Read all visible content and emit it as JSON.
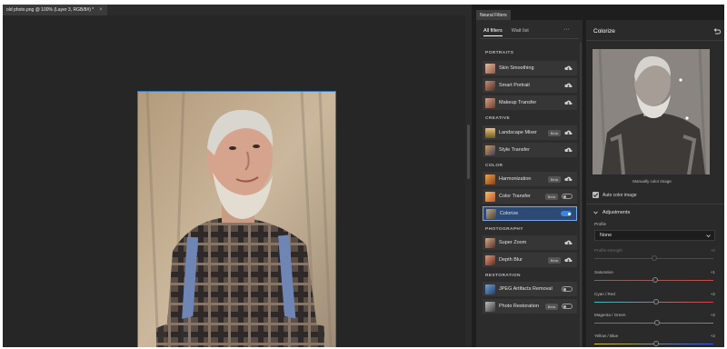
{
  "document": {
    "tab_title": "old photo.png @ 100% (Layer 3, RGB/8#) *",
    "close_icon": "close-icon"
  },
  "neural_filters": {
    "panel_tab": "Neural Filters",
    "tabs": [
      "All filters",
      "Wait list"
    ],
    "more_icon": "more-icon",
    "categories": {
      "portraits": "PORTRAITS",
      "creative": "CREATIVE",
      "color": "COLOR",
      "photography": "PHOTOGRAPHY",
      "restoration": "RESTORATION"
    },
    "filters": {
      "skin_smoothing": {
        "label": "Skin Smoothing"
      },
      "smart_portrait": {
        "label": "Smart Portrait"
      },
      "makeup_transfer": {
        "label": "Makeup Transfer"
      },
      "landscape_mixer": {
        "label": "Landscape Mixer",
        "badge": "Beta"
      },
      "style_transfer": {
        "label": "Style Transfer"
      },
      "harmonization": {
        "label": "Harmonization",
        "badge": "Beta"
      },
      "color_transfer": {
        "label": "Color Transfer",
        "badge": "Beta",
        "enabled": false
      },
      "colorize": {
        "label": "Colorize",
        "enabled": true,
        "selected": true
      },
      "super_zoom": {
        "label": "Super Zoom"
      },
      "depth_blur": {
        "label": "Depth Blur",
        "badge": "Beta"
      },
      "jpeg_artifacts_removal": {
        "label": "JPEG Artifacts Removal",
        "enabled": false
      },
      "photo_restoration": {
        "label": "Photo Restoration",
        "badge": "Beta",
        "enabled": false
      }
    }
  },
  "settings": {
    "title": "Colorize",
    "preview_caption": "Manually color image",
    "auto_color_label": "Auto color image",
    "auto_color_checked": true,
    "adjustments_label": "Adjustments",
    "profile_label": "Profile",
    "profile_value": "None",
    "sliders": {
      "profile_strength": {
        "label": "Profile strength",
        "value": "+0",
        "position": 0.5,
        "disabled": true
      },
      "saturation": {
        "label": "Saturation",
        "value": "+1",
        "position": 0.51
      },
      "cyan_red": {
        "label": "Cyan / Red",
        "value": "+2",
        "position": 0.52
      },
      "magenta_green": {
        "label": "Magenta / Green",
        "value": "+2",
        "position": 0.53
      },
      "yellow_blue": {
        "label": "Yellow / Blue",
        "value": "+2",
        "position": 0.52
      }
    }
  },
  "colors": {
    "accent": "#3b84e3",
    "selected_row": "#2d4a75"
  }
}
